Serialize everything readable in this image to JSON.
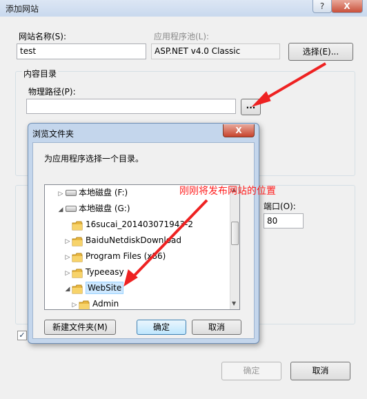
{
  "window": {
    "title": "添加网站",
    "help_label": "?",
    "close_label": "X"
  },
  "site": {
    "name_label": "网站名称(S):",
    "name_value": "test",
    "pool_label": "应用程序池(L):",
    "pool_value": "ASP.NET v4.0 Classic",
    "select_button": "选择(E)..."
  },
  "content_dir": {
    "group_label": "内容目录",
    "path_label": "物理路径(P):",
    "path_value": "",
    "browse_button": "..."
  },
  "binding": {
    "port_label": "端口(O):",
    "port_value": "80"
  },
  "footer": {
    "ok_button": "确定",
    "cancel_button": "取消"
  },
  "browse_dialog": {
    "title": "浏览文件夹",
    "close_label": "X",
    "instruction": "为应用程序选择一个目录。",
    "tree": [
      {
        "label": "本地磁盘 (F:)",
        "type": "disk",
        "expanded": false,
        "indent": 0
      },
      {
        "label": "本地磁盘 (G:)",
        "type": "disk",
        "expanded": true,
        "indent": 0
      },
      {
        "label": "16sucai_201403071943-2",
        "type": "folder",
        "expanded": null,
        "indent": 1
      },
      {
        "label": "BaiduNetdiskDownload",
        "type": "folder",
        "expanded": false,
        "indent": 1
      },
      {
        "label": "Program Files (x86)",
        "type": "folder",
        "expanded": false,
        "indent": 1
      },
      {
        "label": "Typeeasy",
        "type": "folder",
        "expanded": false,
        "indent": 1
      },
      {
        "label": "WebSite",
        "type": "folder",
        "expanded": true,
        "indent": 1,
        "selected": true
      },
      {
        "label": "Admin",
        "type": "folder",
        "expanded": false,
        "indent": 2
      }
    ],
    "new_folder_button": "新建文件夹(M)",
    "ok_button": "确定",
    "cancel_button": "取消"
  },
  "annotation": {
    "text": "刚刚将发布网站的位置",
    "color": "#ff2020"
  }
}
